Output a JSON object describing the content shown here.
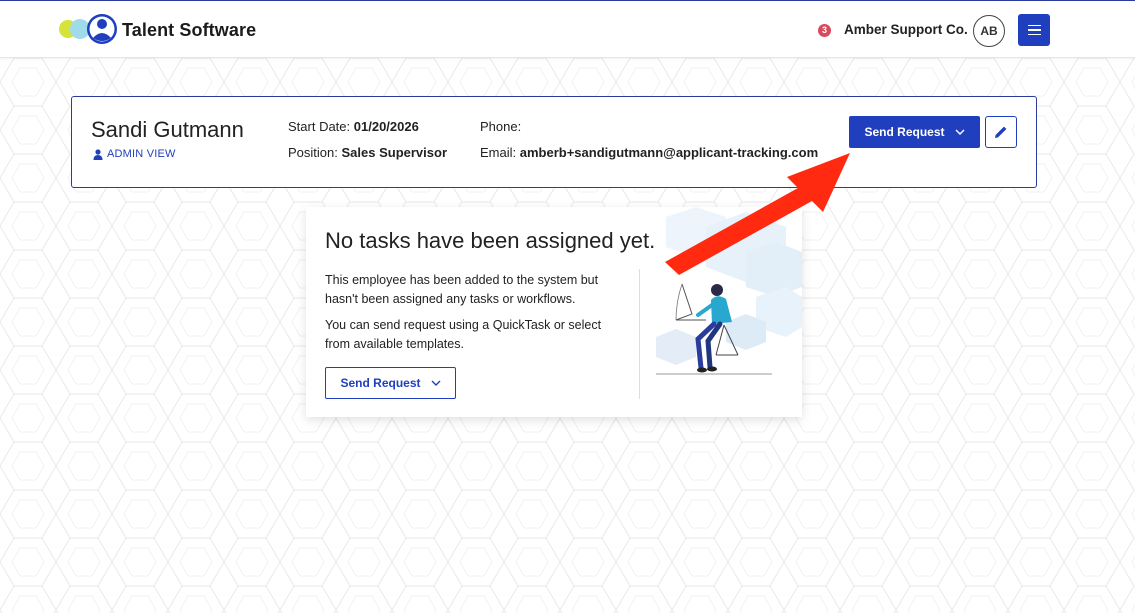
{
  "header": {
    "app_name": "Talent Software",
    "notification_count": "3",
    "company": "Amber Support Co.",
    "avatar_initials": "AB"
  },
  "employee": {
    "name": "Sandi Gutmann",
    "admin_label": "ADMIN VIEW",
    "start_date_label": "Start Date:",
    "start_date": "01/20/2026",
    "position_label": "Position:",
    "position": "Sales Supervisor",
    "phone_label": "Phone:",
    "phone": "",
    "email_label": "Email:",
    "email": "amberb+sandigutmann@applicant-tracking.com",
    "send_request_label": "Send Request"
  },
  "empty_state": {
    "title": "No tasks have been assigned yet.",
    "paragraph1": "This employee has been added to the system but hasn't been assigned any tasks or workflows.",
    "paragraph2": "You can send request using a QuickTask or select from available templates.",
    "send_request_label": "Send Request"
  },
  "colors": {
    "primary": "#1f3fbf",
    "badge": "#d94a5c",
    "annotation_arrow": "#ff2a0f",
    "illustration_accent": "#29a8cf"
  }
}
